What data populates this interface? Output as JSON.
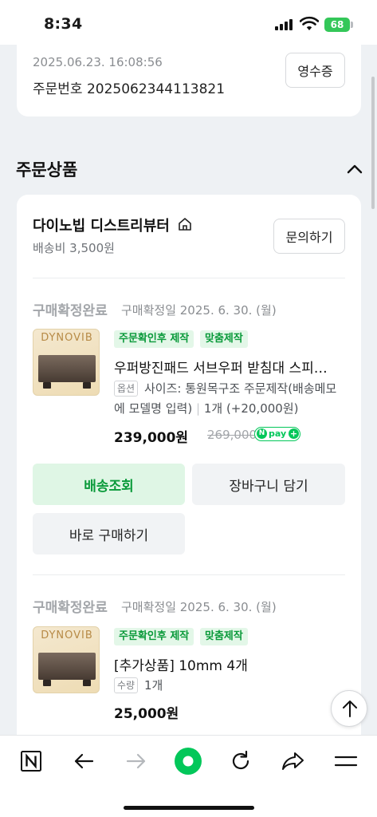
{
  "status_bar": {
    "time": "8:34",
    "battery": "68"
  },
  "order": {
    "date": "2025.06.23. 16:08:56",
    "number_label": "주문번호 2025062344113821",
    "receipt_button": "영수증"
  },
  "section": {
    "title": "주문상품"
  },
  "seller": {
    "name": "다이노빕 디스트리뷰터",
    "shipping_fee": "배송비 3,500원",
    "inquiry_button": "문의하기"
  },
  "items": [
    {
      "status": "구매확정완료",
      "confirm_date": "구매확정일 2025. 6. 30. (월)",
      "thumb_brand": "DYNOVIB",
      "tags": [
        "주문확인후 제작",
        "맞춤제작"
      ],
      "name": "우퍼방진패드 서브우퍼 받침대 스피…",
      "option_badge": "옵션",
      "option_line1": "사이즈: 통원목구조 주문제작(배송메모",
      "option_line2_a": "에 모델명 입력)",
      "option_line2_sep": "|",
      "option_line2_b": "1개 (+20,000원)",
      "price": "239,000원",
      "original_price": "269,000",
      "npay": {
        "n": "N",
        "text": "pay",
        "plus": "+"
      },
      "buttons": {
        "track": "배송조회",
        "cart": "장바구니 담기",
        "buy": "바로 구매하기"
      }
    },
    {
      "status": "구매확정완료",
      "confirm_date": "구매확정일 2025. 6. 30. (월)",
      "thumb_brand": "DYNOVIB",
      "tags": [
        "주문확인후 제작",
        "맞춤제작"
      ],
      "name": "[추가상품] 10mm 4개",
      "option_badge": "수량",
      "option_line1": "1개",
      "price": "25,000원"
    }
  ],
  "nav": {
    "items": [
      "naver-home-icon",
      "back-arrow-icon",
      "forward-arrow-icon",
      "green-dot-icon",
      "refresh-icon",
      "share-icon",
      "menu-icon"
    ]
  },
  "colors": {
    "accent_green": "#03c75a",
    "tag_green": "#0a9a3a",
    "tag_bg": "#e3f7e8"
  }
}
